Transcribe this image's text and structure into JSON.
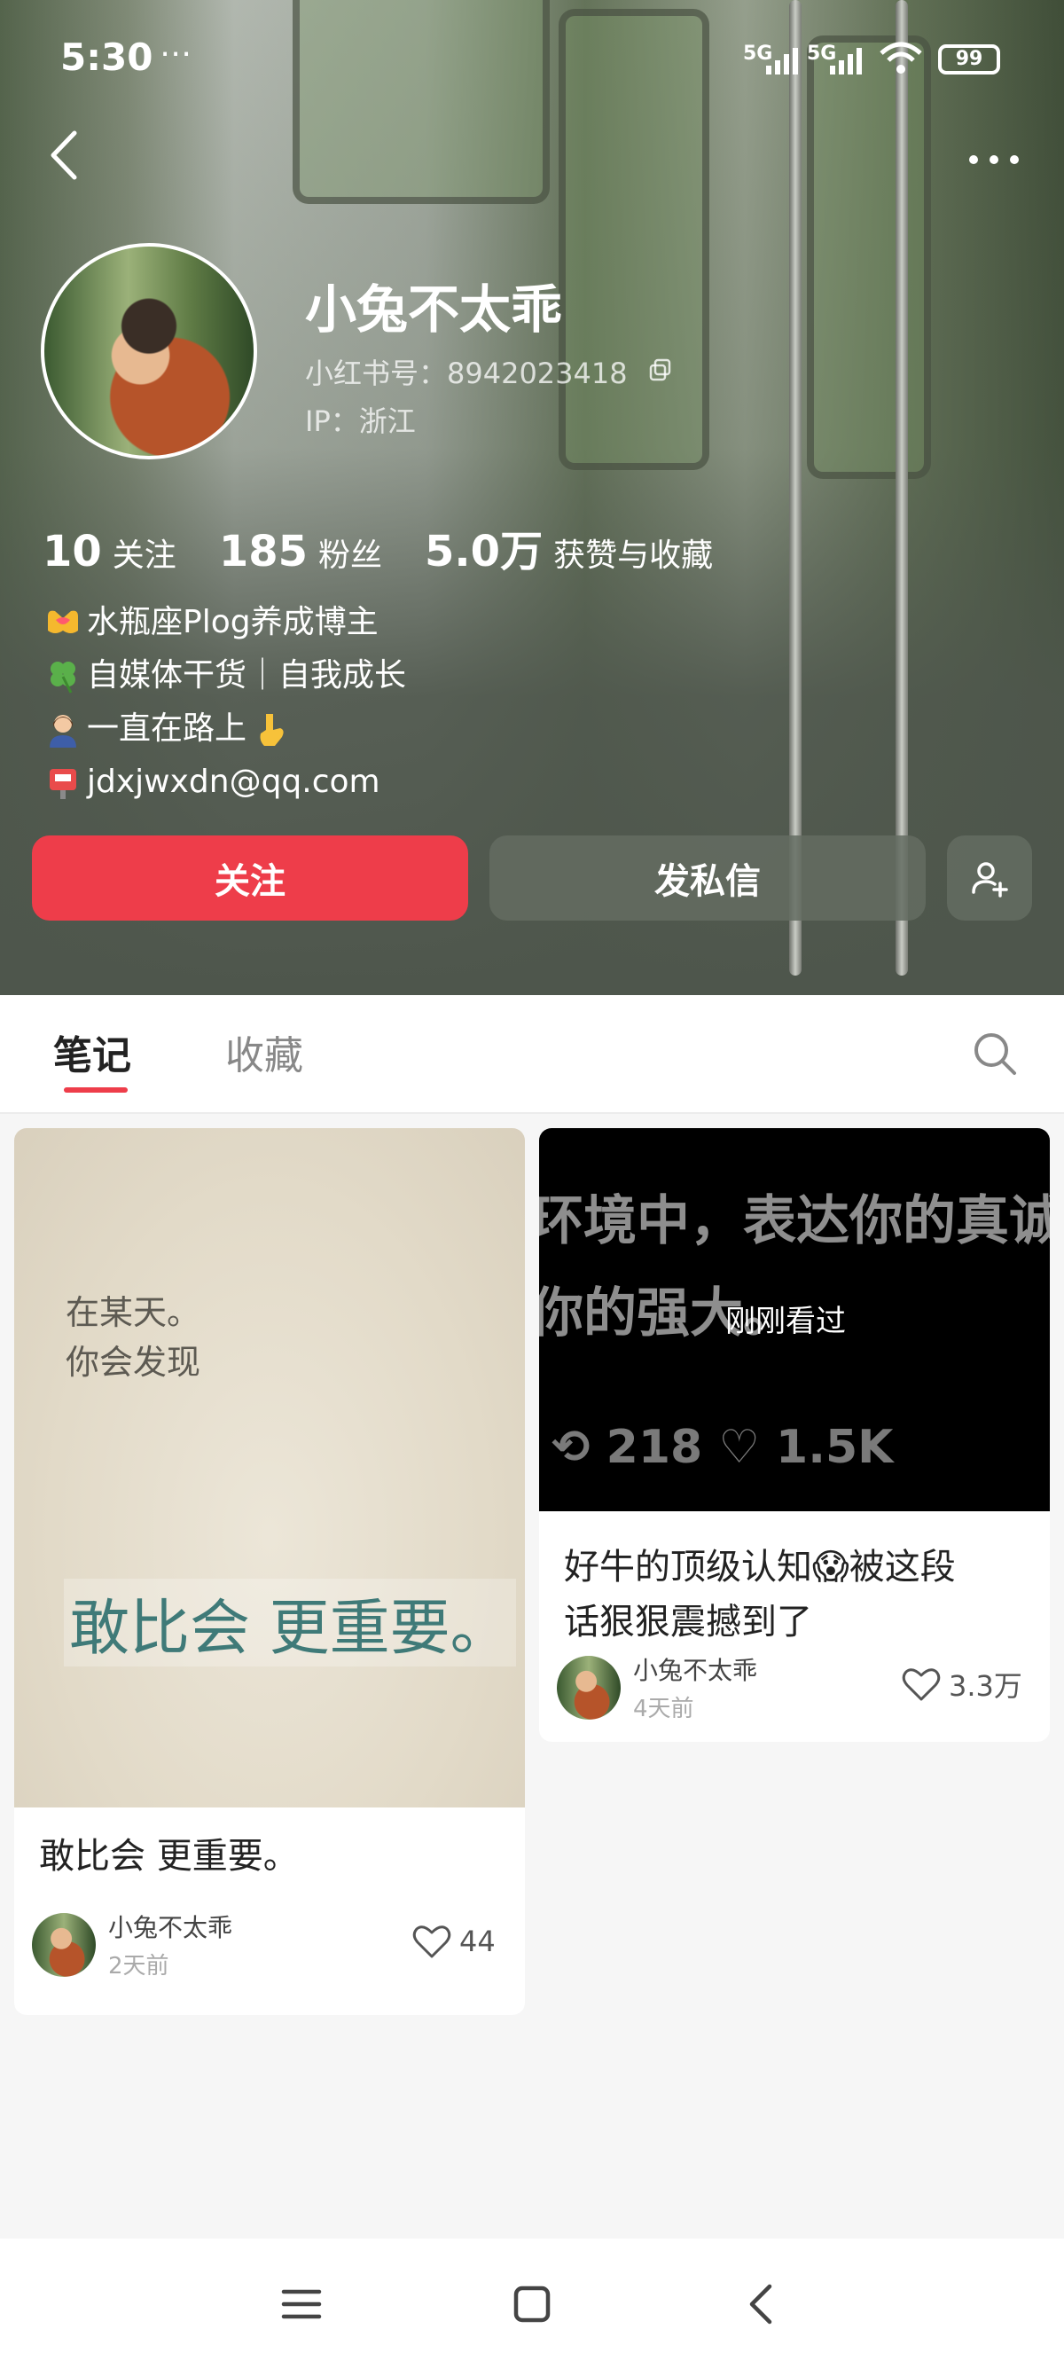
{
  "status_bar": {
    "time": "5:30",
    "extra": "⋯",
    "signal_1": "5G",
    "signal_2": "5G",
    "battery": "99"
  },
  "profile": {
    "nickname": "小兔不太乖",
    "id_label": "小红书号：8942023418",
    "ip_label": "IP：浙江",
    "stats": [
      {
        "num": "10",
        "label": "关注"
      },
      {
        "num": "185",
        "label": "粉丝"
      },
      {
        "num": "5.0万",
        "label": "获赞与收藏"
      }
    ],
    "bio": [
      "水瓶座Plog养成博主",
      "自媒体干货｜自我成长",
      "一直在路上",
      "jdxjwxdn@qq.com"
    ],
    "bio_icons": [
      "heart-hands-icon",
      "four-leaf-clover-icon",
      "woman-office-worker-icon",
      "mailbox-icon"
    ]
  },
  "actions": {
    "follow": "关注",
    "message": "发私信"
  },
  "tabs": {
    "notes": "笔记",
    "collections": "收藏"
  },
  "feed": [
    {
      "cover_small_line_1": "在某天。",
      "cover_small_line_2": "你会发现",
      "cover_big": "敢比会 更重要。",
      "title": "敢比会 更重要。",
      "author": "小兔不太乖",
      "time": "2天前",
      "likes": "44"
    },
    {
      "cover_line_1": "环境中，表达你的真诚",
      "cover_line_2": "你的强大。",
      "cover_stats": "⟲ 218   ♡ 1.5K",
      "recent_label": "刚刚看过",
      "title_line_1": "好牛的顶级认知😱被这段",
      "title_line_2": "话狠狠震撼到了",
      "author": "小兔不太乖",
      "time": "4天前",
      "likes": "3.3万"
    }
  ],
  "colors": {
    "accent_red": "#ee3d4a",
    "header_overlay": "#4e564c"
  }
}
